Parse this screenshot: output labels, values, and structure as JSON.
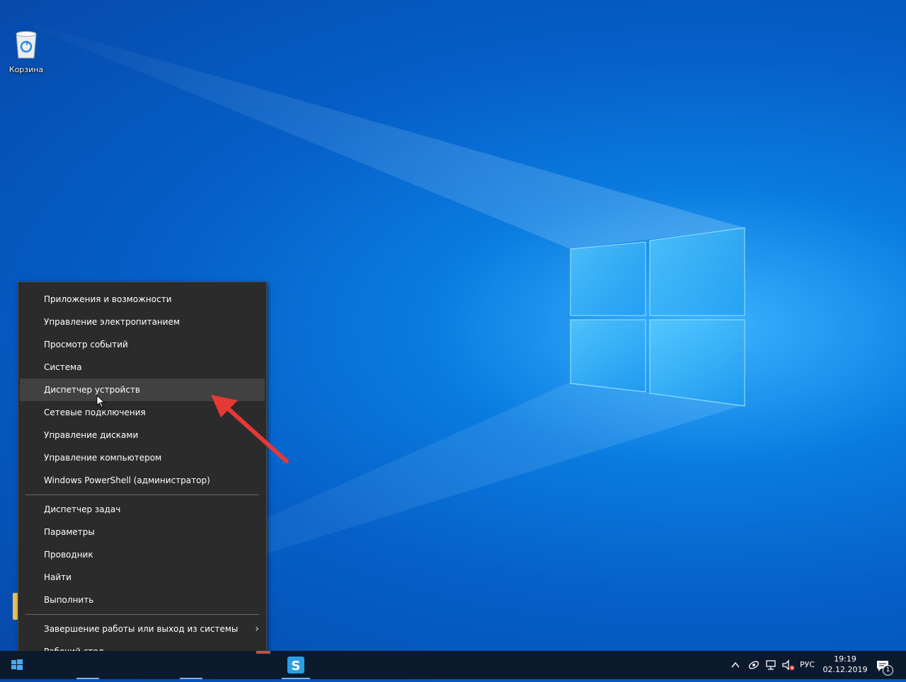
{
  "desktop": {
    "recycle_bin_label": "Корзина"
  },
  "context_menu": {
    "group1": [
      {
        "label": "Приложения и возможности"
      },
      {
        "label": "Управление электропитанием"
      },
      {
        "label": "Просмотр событий"
      },
      {
        "label": "Система"
      },
      {
        "label": "Диспетчер устройств",
        "highlighted": true
      },
      {
        "label": "Сетевые подключения"
      },
      {
        "label": "Управление дисками"
      },
      {
        "label": "Управление компьютером"
      },
      {
        "label": "Windows PowerShell (администратор)"
      }
    ],
    "group2": [
      {
        "label": "Диспетчер задач"
      },
      {
        "label": "Параметры"
      },
      {
        "label": "Проводник"
      },
      {
        "label": "Найти"
      },
      {
        "label": "Выполнить"
      }
    ],
    "group3": [
      {
        "label": "Завершение работы или выход из системы",
        "has_submenu": true
      },
      {
        "label": "Рабочий стол"
      }
    ]
  },
  "taskbar": {
    "language": "РУС",
    "time": "19:19",
    "date": "02.12.2019",
    "notification_count": "1"
  },
  "colors": {
    "menu_bg": "#2b2b2b",
    "menu_hover": "#414141",
    "taskbar_bg": "#0c1a2e",
    "annotation_arrow": "#e53935"
  }
}
